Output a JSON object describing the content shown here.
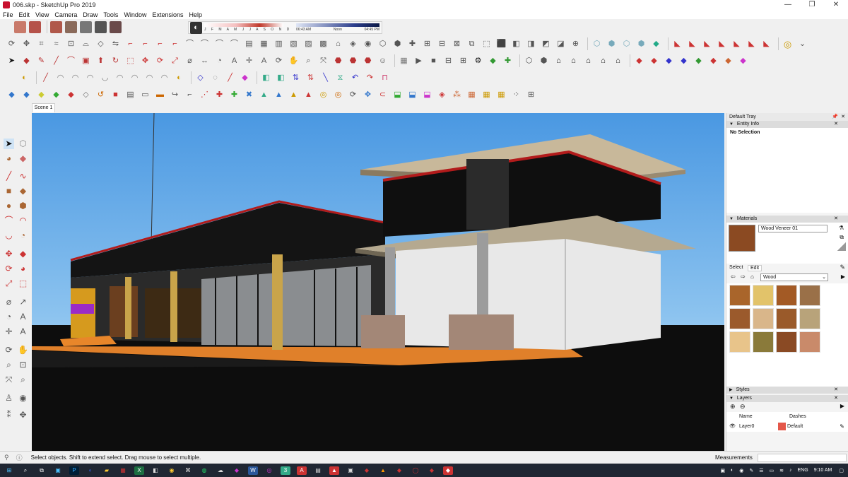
{
  "window": {
    "title": "006.skp - SketchUp Pro 2019",
    "minimize": "—",
    "maximize": "❐",
    "close": "✕"
  },
  "menu": [
    "File",
    "Edit",
    "View",
    "Camera",
    "Draw",
    "Tools",
    "Window",
    "Extensions",
    "Help"
  ],
  "shadows": {
    "months": "J F M A M J J A S O N D",
    "time_start": "06:43 AM",
    "time_mid": "Noon",
    "time_end": "04:45 PM"
  },
  "scene_tab": "Scene 1",
  "tray": {
    "title": "Default Tray",
    "entity_info": {
      "header": "Entity Info",
      "selection": "No Selection"
    },
    "materials": {
      "header": "Materials",
      "material_name": "Wood Veneer 01",
      "tab_select": "Select",
      "tab_edit": "Edit",
      "library": "Wood",
      "swatch_colors": [
        "#a9652b",
        "#e2c36a",
        "#a35a25",
        "#9a7048",
        "#9b5a2c",
        "#d9b68a",
        "#9a5a2a",
        "#b8a37a",
        "#e8c48a",
        "#8a7a3a",
        "#8a4a24",
        "#c98a6a"
      ]
    },
    "styles": {
      "header": "Styles"
    },
    "layers": {
      "header": "Layers",
      "col_name": "Name",
      "col_dashes": "Dashes",
      "row_name": "Layer0",
      "row_dashes": "Default",
      "row_color": "#e4574a"
    }
  },
  "status": {
    "message": "Select objects. Shift to extend select. Drag mouse to select multiple.",
    "measurements_label": "Measurements"
  },
  "taskbar": {
    "lang": "ENG",
    "time": "9:10 AM"
  }
}
